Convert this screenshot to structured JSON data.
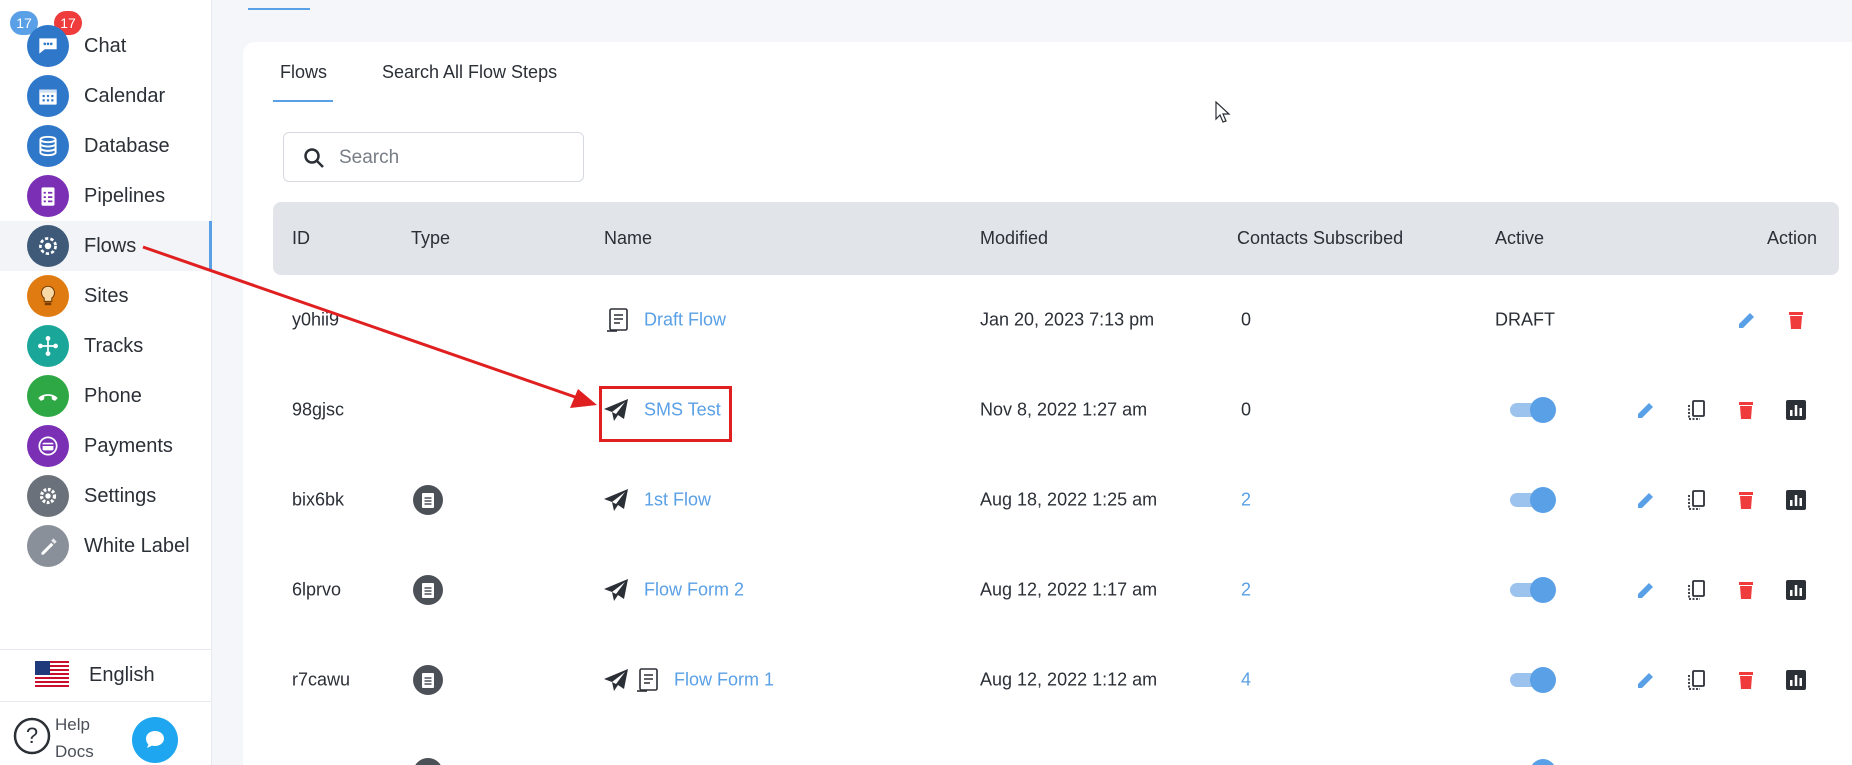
{
  "sidebar": {
    "badges": {
      "left": "17",
      "right": "17"
    },
    "items": [
      {
        "label": "Chat",
        "icon": "chat-icon",
        "color": "#2f77c9"
      },
      {
        "label": "Calendar",
        "icon": "calendar-icon",
        "color": "#2f77c9"
      },
      {
        "label": "Database",
        "icon": "database-icon",
        "color": "#2f77c9"
      },
      {
        "label": "Pipelines",
        "icon": "pipelines-icon",
        "color": "#7a2fb5"
      },
      {
        "label": "Flows",
        "icon": "flows-icon",
        "color": "#3f5a78"
      },
      {
        "label": "Sites",
        "icon": "sites-icon",
        "color": "#e07b12"
      },
      {
        "label": "Tracks",
        "icon": "tracks-icon",
        "color": "#1aa79a"
      },
      {
        "label": "Phone",
        "icon": "phone-icon",
        "color": "#2ea844"
      },
      {
        "label": "Payments",
        "icon": "payments-icon",
        "color": "#7a2fb5"
      },
      {
        "label": "Settings",
        "icon": "settings-icon",
        "color": "#6b717a"
      },
      {
        "label": "White Label",
        "icon": "white-label-icon",
        "color": "#8a9099"
      }
    ],
    "language": "English",
    "help": {
      "line1": "Help",
      "line2": "Docs"
    }
  },
  "tabs": [
    {
      "label": "Flows",
      "active": true
    },
    {
      "label": "Search All Flow Steps",
      "active": false
    }
  ],
  "search": {
    "placeholder": "Search",
    "value": ""
  },
  "table": {
    "headers": {
      "id": "ID",
      "type": "Type",
      "name": "Name",
      "modified": "Modified",
      "contacts": "Contacts Subscribed",
      "active": "Active",
      "action": "Action"
    },
    "rows": [
      {
        "id": "y0hii9",
        "type_icon": false,
        "name_icons": [
          "form-icon"
        ],
        "name": "Draft Flow",
        "modified": "Jan 20, 2023 7:13 pm",
        "contacts": "0",
        "contacts_link": false,
        "active": "DRAFT"
      },
      {
        "id": "98gjsc",
        "type_icon": false,
        "name_icons": [
          "send-icon"
        ],
        "name": "SMS Test",
        "modified": "Nov 8, 2022 1:27 am",
        "contacts": "0",
        "contacts_link": false,
        "active": "on"
      },
      {
        "id": "bix6bk",
        "type_icon": true,
        "name_icons": [
          "send-icon"
        ],
        "name": "1st Flow",
        "modified": "Aug 18, 2022 1:25 am",
        "contacts": "2",
        "contacts_link": true,
        "active": "on"
      },
      {
        "id": "6lprvo",
        "type_icon": true,
        "name_icons": [
          "send-icon"
        ],
        "name": "Flow Form 2",
        "modified": "Aug 12, 2022 1:17 am",
        "contacts": "2",
        "contacts_link": true,
        "active": "on"
      },
      {
        "id": "r7cawu",
        "type_icon": true,
        "name_icons": [
          "send-icon",
          "form-icon"
        ],
        "name": "Flow Form 1",
        "modified": "Aug 12, 2022 1:12 am",
        "contacts": "4",
        "contacts_link": true,
        "active": "on"
      }
    ]
  },
  "colors": {
    "accent": "#5aa0e6",
    "delete": "#ef3b3b",
    "annotation": "#e02020"
  }
}
